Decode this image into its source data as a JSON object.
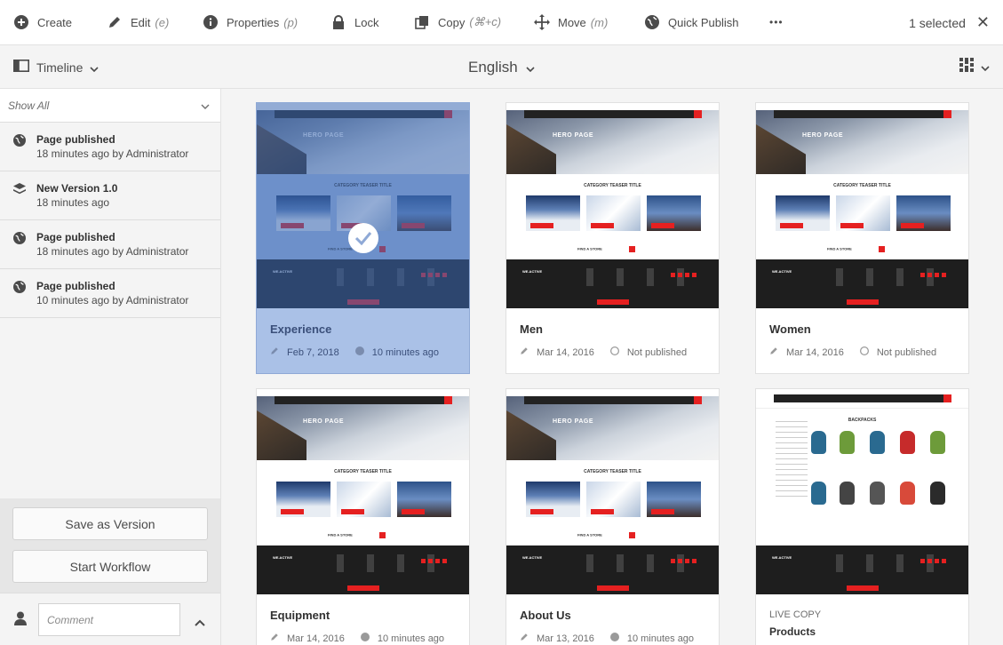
{
  "toolbar": {
    "create": "Create",
    "edit": "Edit",
    "edit_hint": "(e)",
    "properties": "Properties",
    "properties_hint": "(p)",
    "lock": "Lock",
    "copy": "Copy",
    "copy_hint": "(⌘+c)",
    "move": "Move",
    "move_hint": "(m)",
    "quick_publish": "Quick Publish",
    "more": "•••",
    "selected": "1 selected",
    "close": "✕"
  },
  "subbar": {
    "rail_label": "Timeline",
    "language": "English"
  },
  "rail": {
    "filter": "Show All",
    "items": [
      {
        "icon": "globe-icon",
        "title": "Page published",
        "sub": "18 minutes ago by Administrator"
      },
      {
        "icon": "layers-icon",
        "title": "New Version 1.0",
        "sub": "18 minutes ago"
      },
      {
        "icon": "globe-icon",
        "title": "Page published",
        "sub": "18 minutes ago by Administrator"
      },
      {
        "icon": "globe-icon",
        "title": "Page published",
        "sub": "10 minutes ago by Administrator"
      }
    ],
    "save_version": "Save as Version",
    "start_workflow": "Start Workflow",
    "comment_placeholder": "Comment"
  },
  "cards": [
    {
      "title": "Experience",
      "date": "Feb 7, 2018",
      "status": "10 minutes ago",
      "selected": true
    },
    {
      "title": "Men",
      "date": "Mar 14, 2016",
      "status": "Not published"
    },
    {
      "title": "Women",
      "date": "Mar 14, 2016",
      "status": "Not published"
    },
    {
      "title": "Equipment",
      "date": "Mar 14, 2016",
      "status": "10 minutes ago"
    },
    {
      "title": "About Us",
      "date": "Mar 13, 2016",
      "status": "10 minutes ago"
    },
    {
      "live_copy": "LIVE COPY",
      "title": "Products"
    }
  ],
  "thumb": {
    "hero": "HERO PAGE",
    "category": "CATEGORY TEASER TITLE",
    "store": "FIND A STORE",
    "brand": "WE.ACTIVE",
    "products_title": "BACKPACKS"
  },
  "colors": {
    "accent": "#e52020",
    "selection": "#aac1e7"
  }
}
